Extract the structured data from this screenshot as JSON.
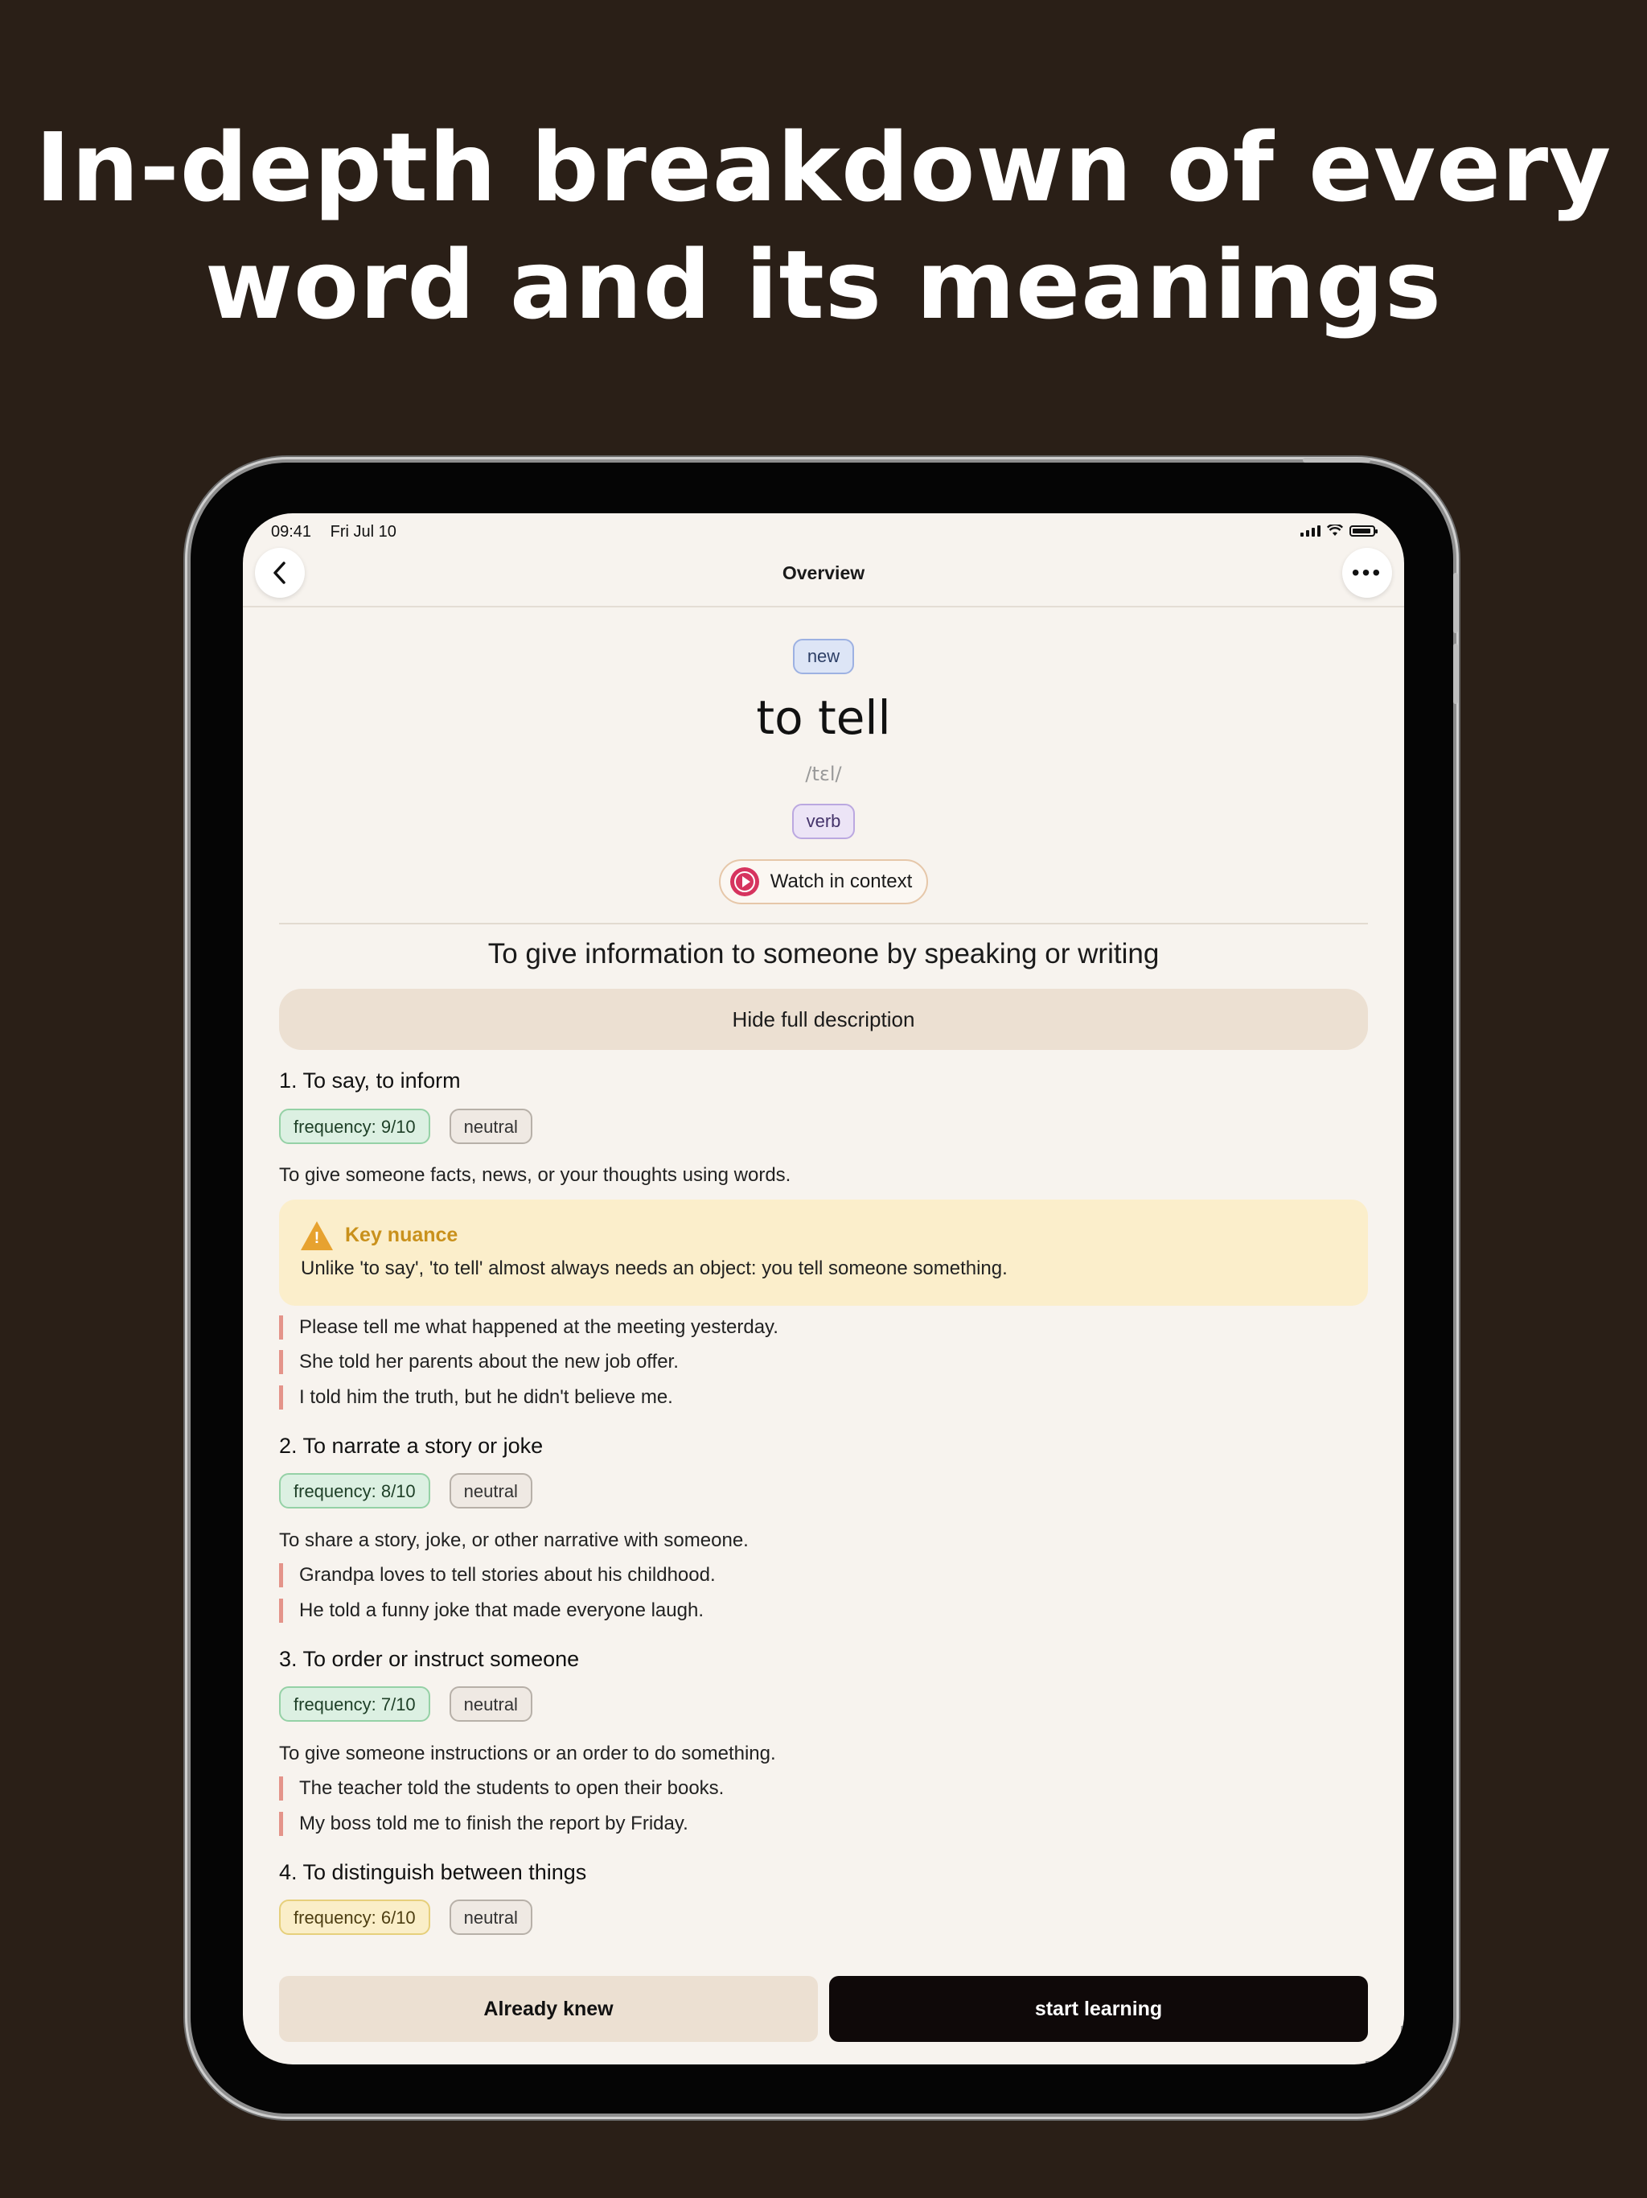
{
  "headline": {
    "line1": "In-depth breakdown of every",
    "line2": "word and its meanings"
  },
  "status": {
    "time": "09:41",
    "date": "Fri Jul 10"
  },
  "nav": {
    "title": "Overview",
    "more": "•••",
    "back": "‹"
  },
  "word": {
    "status_chip": "new",
    "text": "to tell",
    "ipa": "/tɛl/",
    "part_of_speech": "verb",
    "watch_label": "Watch in context",
    "summary": "To give information to someone by speaking or writing",
    "toggle_label": "Hide full description"
  },
  "senses": [
    {
      "title": "1. To say, to inform",
      "frequency": "frequency: 9/10",
      "register": "neutral",
      "description": "To give someone facts, news, or your thoughts using words.",
      "nuance_title": "Key nuance",
      "nuance_text": "Unlike 'to say', 'to tell' almost always needs an object: you tell someone something.",
      "examples": [
        "Please tell me what happened at the meeting yesterday.",
        "She told her parents about the new job offer.",
        "I told him the truth, but he didn't believe me."
      ]
    },
    {
      "title": "2. To narrate a story or joke",
      "frequency": "frequency: 8/10",
      "register": "neutral",
      "description": "To share a story, joke, or other narrative with someone.",
      "examples": [
        "Grandpa loves to tell stories about his childhood.",
        "He told a funny joke that made everyone laugh."
      ]
    },
    {
      "title": "3. To order or instruct someone",
      "frequency": "frequency: 7/10",
      "register": "neutral",
      "description": "To give someone instructions or an order to do something.",
      "examples": [
        "The teacher told the students to open their books.",
        "My boss told me to finish the report by Friday."
      ]
    },
    {
      "title": "4. To distinguish between things",
      "frequency": "frequency: 6/10",
      "register": "neutral"
    }
  ],
  "actions": {
    "already_knew": "Already knew",
    "start_learning": "start learning"
  },
  "colors": {
    "background": "#2a1f17",
    "screen": "#f7f3ee",
    "accent": "#d6345f",
    "primary_button": "#0f0909"
  }
}
